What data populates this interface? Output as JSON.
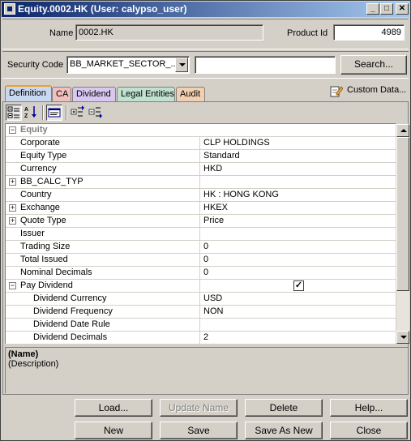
{
  "window": {
    "title": "Equity.0002.HK (User: calypso_user)",
    "minimize": "_",
    "maximize": "□",
    "close": "✕"
  },
  "header": {
    "name_label": "Name",
    "name_value": "0002.HK",
    "product_id_label": "Product Id",
    "product_id_value": "4989"
  },
  "security": {
    "label": "Security Code",
    "code_value": "BB_MARKET_SECTOR_...",
    "search_value": "",
    "search_button": "Search..."
  },
  "tabs": [
    {
      "label": "Definition",
      "color": "#c8d8f0",
      "active": true
    },
    {
      "label": "CA",
      "color": "#f0c0c0",
      "active": false
    },
    {
      "label": "Dividend",
      "color": "#d8c8f0",
      "active": false
    },
    {
      "label": "Legal Entities",
      "color": "#c0e0d0",
      "active": false
    },
    {
      "label": "Audit",
      "color": "#f0d0b0",
      "active": false
    }
  ],
  "custom_data": {
    "label": "Custom Data...",
    "icon": "pencil-edit-icon"
  },
  "toolbar": {
    "icons": [
      "categorized-view-icon",
      "sort-alpha-icon",
      "description-toggle-icon",
      "expand-all-icon",
      "collapse-all-icon"
    ]
  },
  "properties": [
    {
      "name": "Equity",
      "value": "",
      "kind": "section",
      "expander": "−"
    },
    {
      "name": "Corporate",
      "value": "CLP HOLDINGS",
      "kind": "prop"
    },
    {
      "name": "Equity Type",
      "value": "Standard",
      "kind": "prop"
    },
    {
      "name": "Currency",
      "value": "HKD",
      "kind": "prop"
    },
    {
      "name": "BB_CALC_TYP",
      "value": "",
      "kind": "expandable",
      "expander": "+"
    },
    {
      "name": "Country",
      "value": "HK : HONG KONG",
      "kind": "prop"
    },
    {
      "name": "Exchange",
      "value": "HKEX",
      "kind": "expandable",
      "expander": "+"
    },
    {
      "name": "Quote Type",
      "value": "Price",
      "kind": "expandable",
      "expander": "+"
    },
    {
      "name": "Issuer",
      "value": "",
      "kind": "prop"
    },
    {
      "name": "Trading Size",
      "value": "0",
      "kind": "prop"
    },
    {
      "name": "Total Issued",
      "value": "0",
      "kind": "prop"
    },
    {
      "name": "Nominal Decimals",
      "value": "0",
      "kind": "prop"
    },
    {
      "name": "Pay Dividend",
      "value": "✓",
      "kind": "checkbox",
      "expander": "−"
    },
    {
      "name": "Dividend Currency",
      "value": "USD",
      "kind": "child"
    },
    {
      "name": "Dividend Frequency",
      "value": "NON",
      "kind": "child"
    },
    {
      "name": "Dividend Date Rule",
      "value": "",
      "kind": "child"
    },
    {
      "name": "Dividend Decimals",
      "value": "2",
      "kind": "child"
    }
  ],
  "description": {
    "name": "(Name)",
    "text": "(Description)"
  },
  "buttons": {
    "row1": [
      "Load...",
      "Update Name",
      "Delete",
      "Help..."
    ],
    "row2": [
      "New",
      "Save",
      "Save As New",
      "Close"
    ]
  }
}
